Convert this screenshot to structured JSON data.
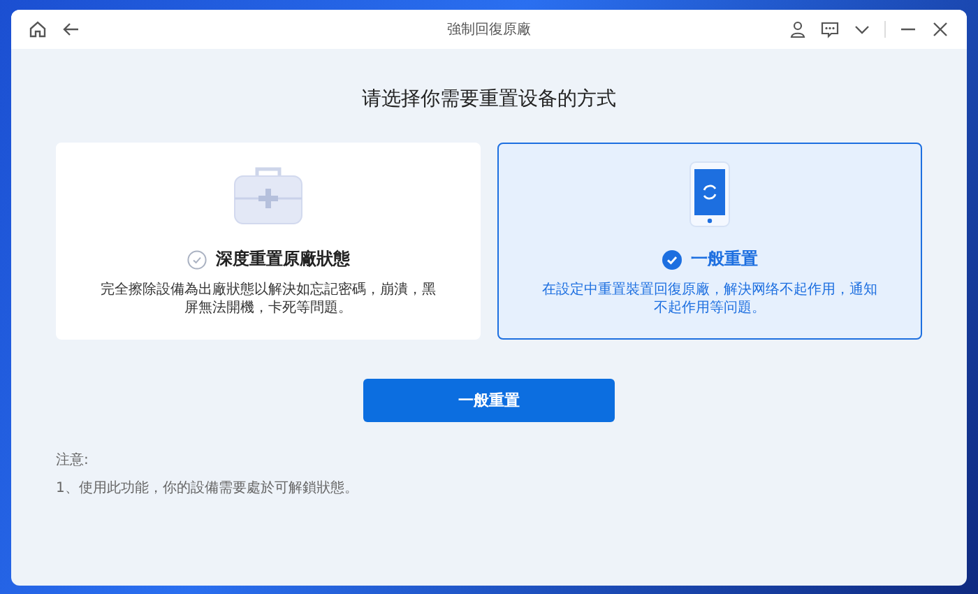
{
  "window": {
    "title": "強制回復原廠"
  },
  "heading": "请选择你需要重置设备的方式",
  "options": [
    {
      "kind": "toolbox",
      "title": "深度重置原廠狀態",
      "description": "完全擦除設備為出廠狀態以解決如忘記密碼，崩潰，黑屏無法開機，卡死等問題。",
      "selected": false
    },
    {
      "kind": "phone",
      "title": "一般重置",
      "description": "在設定中重置裝置回復原廠，解決网络不起作用，通知不起作用等问題。",
      "selected": true
    }
  ],
  "action_button": "一般重置",
  "notes": {
    "title": "注意:",
    "items": [
      "1、使用此功能，你的設備需要處於可解鎖狀態。"
    ]
  }
}
